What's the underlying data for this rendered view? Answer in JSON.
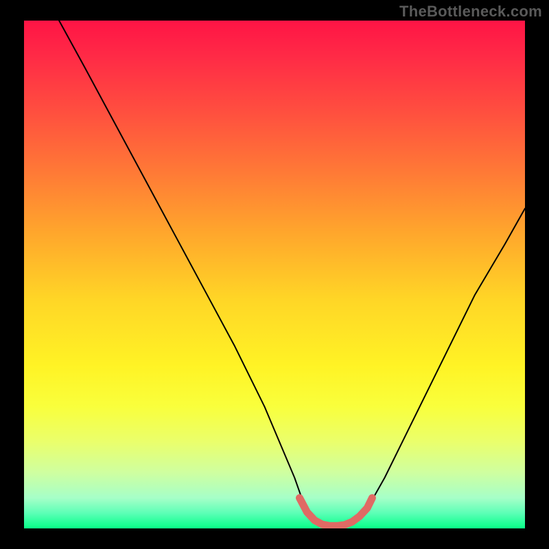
{
  "watermark": "TheBottleneck.com",
  "chart_data": {
    "type": "line",
    "title": "",
    "xlabel": "",
    "ylabel": "",
    "xlim": [
      0,
      100
    ],
    "ylim": [
      0,
      100
    ],
    "grid": false,
    "legend": false,
    "gradient_background": {
      "stops": [
        {
          "offset": 0,
          "color": "#ff1445"
        },
        {
          "offset": 7,
          "color": "#ff2a46"
        },
        {
          "offset": 18,
          "color": "#ff4f3f"
        },
        {
          "offset": 30,
          "color": "#ff7a36"
        },
        {
          "offset": 42,
          "color": "#ffa72c"
        },
        {
          "offset": 55,
          "color": "#ffd626"
        },
        {
          "offset": 68,
          "color": "#fff325"
        },
        {
          "offset": 76,
          "color": "#f9ff3c"
        },
        {
          "offset": 83,
          "color": "#eaff6c"
        },
        {
          "offset": 89,
          "color": "#cfffa0"
        },
        {
          "offset": 94,
          "color": "#a6ffc8"
        },
        {
          "offset": 97,
          "color": "#5cffb6"
        },
        {
          "offset": 99,
          "color": "#21ff98"
        },
        {
          "offset": 100,
          "color": "#0aff86"
        }
      ]
    },
    "series": [
      {
        "name": "bottleneck-curve-left",
        "stroke": "#000000",
        "x": [
          7,
          12,
          18,
          24,
          30,
          36,
          42,
          48,
          54,
          56.5
        ],
        "y": [
          100,
          91,
          80,
          69,
          58,
          47,
          36,
          24,
          10,
          3
        ]
      },
      {
        "name": "bottleneck-curve-right",
        "stroke": "#000000",
        "x": [
          68,
          72,
          78,
          84,
          90,
          96,
          100
        ],
        "y": [
          3,
          10,
          22,
          34,
          46,
          56,
          63
        ]
      },
      {
        "name": "bottleneck-valley-highlight",
        "stroke": "#e06a64",
        "x": [
          55,
          56.5,
          58,
          59.5,
          61,
          62.5,
          64,
          65.5,
          67,
          68.5,
          69.5
        ],
        "y": [
          6,
          3.2,
          1.6,
          0.8,
          0.5,
          0.5,
          0.7,
          1.3,
          2.4,
          4,
          6
        ]
      }
    ]
  }
}
